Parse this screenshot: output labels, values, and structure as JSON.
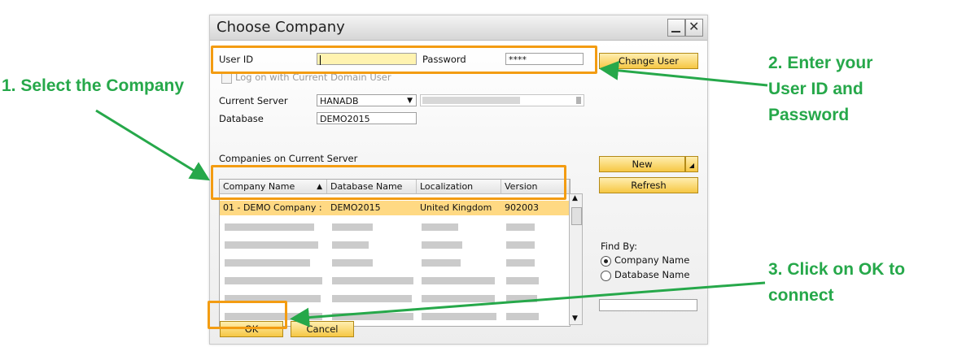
{
  "window": {
    "title": "Choose Company",
    "close_glyph": "✕"
  },
  "login": {
    "user_id_label": "User ID",
    "user_id_value": "",
    "password_label": "Password",
    "password_value": "****",
    "change_user_button": "Change User",
    "domain_checkbox_label": "Log on with Current Domain User"
  },
  "server": {
    "current_server_label": "Current Server",
    "current_server_value": "HANADB",
    "database_label": "Database",
    "database_value": "DEMO2015"
  },
  "companies": {
    "section_label": "Companies on Current Server",
    "columns": [
      "Company Name",
      "Database Name",
      "Localization",
      "Version"
    ],
    "selected_row": {
      "company_name": "01 - DEMO Company :",
      "database_name": "DEMO2015",
      "localization": "United Kingdom",
      "version": "902003"
    }
  },
  "side_buttons": {
    "new": "New",
    "refresh": "Refresh"
  },
  "find_by": {
    "label": "Find By:",
    "options": [
      "Company Name",
      "Database Name"
    ],
    "selected": "Company Name",
    "search_value": ""
  },
  "footer": {
    "ok": "OK",
    "cancel": "Cancel"
  },
  "annotations": {
    "step1": "1. Select the Company",
    "step2_line1": "2. Enter your",
    "step2_line2": "User ID and",
    "step2_line3": "Password",
    "step3_line1": "3. Click on OK to",
    "step3_line2": "connect"
  },
  "colors": {
    "highlight": "#f39c12",
    "arrow": "#26a84a",
    "selected_row": "#ffd983",
    "button": "#f6c744"
  }
}
